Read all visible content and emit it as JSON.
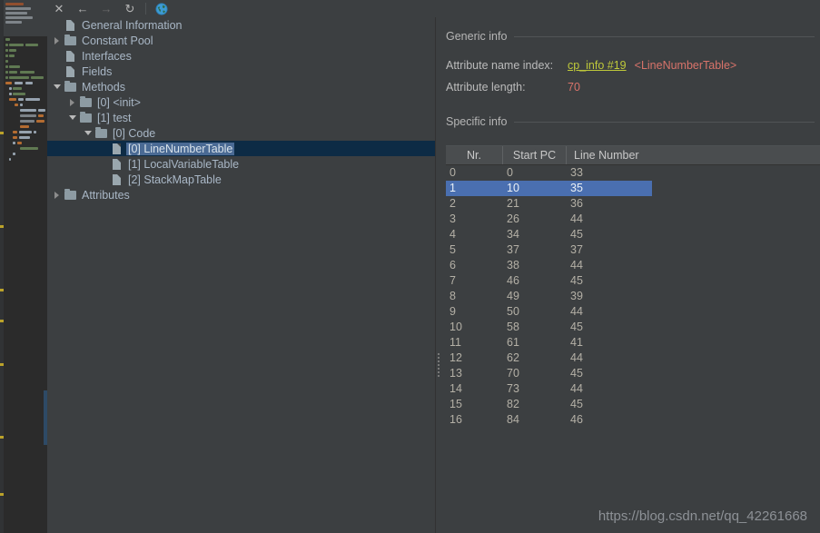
{
  "toolbar": {
    "close_label": "✕",
    "back_label": "←",
    "forward_label": "→",
    "reload_label": "↻",
    "browser_label": "globe-icon"
  },
  "tree": {
    "items": [
      {
        "label": "General Information",
        "indent": 1,
        "expander": "none",
        "icon": "document-icon",
        "selected": false
      },
      {
        "label": "Constant Pool",
        "indent": 1,
        "expander": "closed",
        "icon": "folder-icon",
        "selected": false
      },
      {
        "label": "Interfaces",
        "indent": 1,
        "expander": "none",
        "icon": "document-icon",
        "selected": false
      },
      {
        "label": "Fields",
        "indent": 1,
        "expander": "none",
        "icon": "document-icon",
        "selected": false
      },
      {
        "label": "Methods",
        "indent": 1,
        "expander": "open",
        "icon": "folder-icon",
        "selected": false
      },
      {
        "label": "[0] <init>",
        "indent": 2,
        "expander": "closed",
        "icon": "folder-icon",
        "selected": false
      },
      {
        "label": "[1] test",
        "indent": 2,
        "expander": "open",
        "icon": "folder-icon",
        "selected": false
      },
      {
        "label": "[0] Code",
        "indent": 3,
        "expander": "open",
        "icon": "folder-icon",
        "selected": false
      },
      {
        "label": "[0] LineNumberTable",
        "indent": 4,
        "expander": "none",
        "icon": "document-icon",
        "selected": true
      },
      {
        "label": "[1] LocalVariableTable",
        "indent": 4,
        "expander": "none",
        "icon": "document-icon",
        "selected": false
      },
      {
        "label": "[2] StackMapTable",
        "indent": 4,
        "expander": "none",
        "icon": "document-icon",
        "selected": false
      },
      {
        "label": "Attributes",
        "indent": 1,
        "expander": "closed",
        "icon": "folder-icon",
        "selected": false
      }
    ]
  },
  "detail": {
    "generic_info_title": "Generic info",
    "specific_info_title": "Specific info",
    "attribute_name_index_label": "Attribute name index:",
    "attribute_name_index_link": "cp_info #19",
    "attribute_name_index_value": "<LineNumberTable>",
    "attribute_length_label": "Attribute length:",
    "attribute_length_value": "70"
  },
  "table": {
    "columns": [
      "Nr.",
      "Start PC",
      "Line Number"
    ],
    "selected_row": 1,
    "rows": [
      [
        "0",
        "0",
        "33"
      ],
      [
        "1",
        "10",
        "35"
      ],
      [
        "2",
        "21",
        "36"
      ],
      [
        "3",
        "26",
        "44"
      ],
      [
        "4",
        "34",
        "45"
      ],
      [
        "5",
        "37",
        "37"
      ],
      [
        "6",
        "38",
        "44"
      ],
      [
        "7",
        "46",
        "45"
      ],
      [
        "8",
        "49",
        "39"
      ],
      [
        "9",
        "50",
        "44"
      ],
      [
        "10",
        "58",
        "45"
      ],
      [
        "11",
        "61",
        "41"
      ],
      [
        "12",
        "62",
        "44"
      ],
      [
        "13",
        "70",
        "45"
      ],
      [
        "14",
        "73",
        "44"
      ],
      [
        "15",
        "82",
        "45"
      ],
      [
        "16",
        "84",
        "46"
      ]
    ]
  },
  "watermark": {
    "text": "https://blog.csdn.net/qq_42261668"
  },
  "colors": {
    "background": "#3c3f41",
    "editor_background": "#2b2b2b",
    "tree_text": "#a9b7c6",
    "selection_blue": "#4a6fb0",
    "tree_selection_row": "#0d2b45",
    "tree_selection_text_bg": "#4a6a94",
    "link_yellow": "#bfc93a",
    "value_red": "#d8736a"
  }
}
